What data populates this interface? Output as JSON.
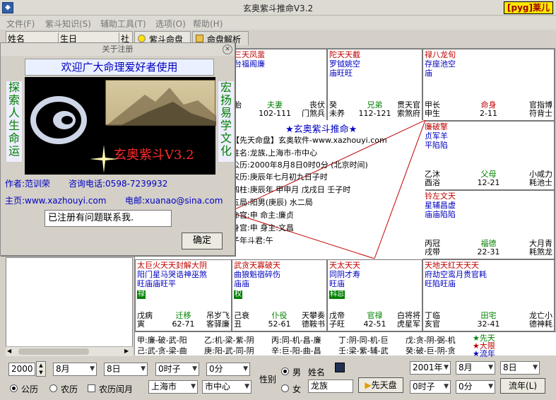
{
  "window": {
    "title": "玄奥紫斗推命V3.2",
    "brand": "[pyg]莱儿"
  },
  "menu": [
    "文件(F)",
    "紫斗知识(S)",
    "辅助工具(T)",
    "选项(O)",
    "帮助(H)"
  ],
  "list": {
    "col_name": "姓名",
    "col_birth": "生日",
    "col_3": "社"
  },
  "tabs": [
    "紫斗命盘",
    "命盘解析"
  ],
  "dialog": {
    "title": "关于注册",
    "welcome": "欢迎广大命理爱好者使用",
    "left_vertical": "探索人生命运",
    "right_vertical": "宏扬易学文化",
    "banner_text": "玄奥紫斗V3.2",
    "author_label": "作者:范训荣",
    "phone_label": "咨询电话:0598-7239932",
    "home_label": "主页:www.xazhouyi.com",
    "email_label": "电邮:xuanao@sina.com",
    "reg_text": "已注册有问题联系我.",
    "ok": "确定"
  },
  "palaces": [
    {
      "stars": "三天凤蜚\n台福阁廉",
      "l1": "",
      "l2": "胎",
      "mid": "夫妻",
      "mid2": "102-111",
      "r1": "丧伏",
      "r2": "门煞兵"
    },
    {
      "stars": "陀天天截\n罗钺姚空\n庙旺旺",
      "l1": "癸",
      "l2": "未养",
      "mid": "兄弟",
      "mid2": "112-121",
      "r1": "贯天官",
      "r2": "索煞府"
    },
    {
      "stars": "禄八龙旬\n存座池空\n庙",
      "l1": "甲长",
      "l2": "申生",
      "mid": "命身",
      "mid2": "2-11",
      "r1": "官指博",
      "r2": "符背士"
    },
    {
      "stars": "廉破擎\n贞军羊\n平陷陷",
      "l1": "乙沐",
      "l2": "酉浴",
      "mid": "父母",
      "mid2": "12-21",
      "r1": "小咸力",
      "r2": "耗池士"
    },
    {
      "stars": "铃左文天\n星辅昌虚\n庙庙陷陷",
      "l1": "丙冠",
      "l2": "戌带",
      "mid": "福德",
      "mid2": "22-31",
      "r1": "大月青",
      "r2": "耗煞龙"
    },
    {
      "stars": "天地天红天天天\n府劫空鸾月贵官耗\n旺陷旺庙",
      "l1": "丁临",
      "l2": "亥官",
      "mid": "田宅",
      "mid2": "32-41",
      "r1": "龙亡小",
      "r2": "德神耗"
    },
    {
      "stars": "天太天天\n同阴才寿\n旺庙",
      "badge": "科忌",
      "l1": "戊帝",
      "l2": "子旺",
      "mid": "官禄",
      "mid2": "42-51",
      "r1": "白将将",
      "r2": "虎星军"
    },
    {
      "stars": "武贪天寡破天\n曲狼魁宿碎伤\n庙庙",
      "badge": "权",
      "l1": "己衰",
      "l2": "丑",
      "mid": "仆役",
      "mid2": "52-61",
      "r1": "天攀奏",
      "r2": "德鞍书"
    },
    {
      "stars": "太巨火天天封解大阴\n阳门星马哭诰神巫煞\n旺庙庙旺平",
      "badge": "禄",
      "l1": "戊病",
      "l2": "寅",
      "mid": "迁移",
      "mid2": "62-71",
      "r1": "吊岁飞",
      "r2": "客驿廉"
    }
  ],
  "center": {
    "title": "★玄奥紫斗推命★",
    "lines": [
      "【先天命盘】玄奥软件-www.xazhouyi.com",
      "姓名:龙族,上海市-市中心",
      "公历:2000年8月8日0时0分 (北京时间)",
      "农历:庚辰年七月初九日子时",
      "四柱:庚辰年 甲申月 戊戌日 壬子时",
      "五局:阳男(庚辰) 水二局",
      "命宫:申        命主:廉贞",
      "身宫:申        身主:文昌",
      "子年斗君:午"
    ]
  },
  "stem_table": [
    [
      "甲:廉-破-武-阳",
      "乙:机-梁-紫-阴",
      "丙:同-机-昌-廉",
      "丁:阴-同-机-巨",
      "戊:贪-阴-弼-机"
    ],
    [
      "己:武-贪-梁-曲",
      "庚:阳-武-同-阴",
      "辛:巨-阳-曲-昌",
      "壬:梁-紫-辅-武",
      "癸:破-巨-阴-贪"
    ]
  ],
  "legend": [
    "★先天",
    "★大限",
    "★流年"
  ],
  "controls": {
    "year": "2000",
    "month": "8月",
    "day": "8日",
    "hour": "0时子",
    "minute": "0分",
    "gender_label": "性别",
    "name_label": "姓名",
    "male": "男",
    "female": "女",
    "name_value": "龙族",
    "solar": "公历",
    "lunar": "农历",
    "lunar_leap": "农历闰月",
    "city": "上海市",
    "district": "市中心",
    "natal_button": "先天盘",
    "f_year": "2001年",
    "f_month": "8月",
    "f_day": "8日",
    "f_hour": "0时子",
    "f_minute": "0分",
    "liunian_button": "流年(L)"
  },
  "colors": {
    "accent_blue": "#0000c0",
    "star_red": "#c00000",
    "green": "#008000"
  }
}
